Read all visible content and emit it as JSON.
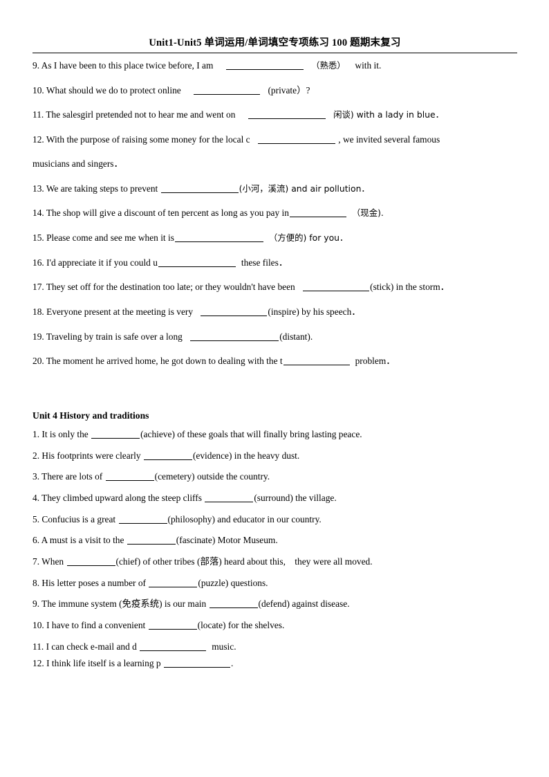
{
  "document": {
    "header_title": "Unit1-Unit5 单词运用/单词填空专项练习 100 题期末复习",
    "section_one": {
      "items": [
        {
          "number": "9.",
          "before": "As I have been to this place twice before, I am",
          "hint": "（熟悉）",
          "after": "with it."
        },
        {
          "number": "10.",
          "before": "What should we do to protect online",
          "hint": "(private）?",
          "after": ""
        },
        {
          "number": "11.",
          "before": "The salesgirl pretended not to hear me and went on",
          "hint": "闲谈) with a lady in blue．",
          "after": ""
        },
        {
          "number": "12.",
          "before": "With the purpose of raising some money for the local c",
          "hint": ", we invited several famous",
          "after": "musicians and singers．"
        },
        {
          "number": "13.",
          "before": "We are taking steps to prevent",
          "hint": "(小河，溪流) and air pollution．",
          "after": ""
        },
        {
          "number": "14.",
          "before": "The shop will give a discount of ten percent as long as you pay in",
          "hint": "（现金).",
          "after": ""
        },
        {
          "number": "15.",
          "before": "Please come and see me when it is",
          "hint": "（方便的) for you．",
          "after": ""
        },
        {
          "number": "16.",
          "before": "I'd appreciate it if you could u",
          "hint": "these files．",
          "after": ""
        },
        {
          "number": "17.",
          "before": "They set off for the destination too late; or they wouldn't have been",
          "hint": "(stick) in the storm．",
          "after": ""
        },
        {
          "number": "18.",
          "before": "Everyone present at the meeting is very",
          "hint": "(inspire) by his speech．",
          "after": ""
        },
        {
          "number": "19.",
          "before": "Traveling by train is safe over a long",
          "hint": "(distant).",
          "after": ""
        },
        {
          "number": "20.",
          "before": "The moment he arrived home, he got down to dealing with the t",
          "hint": "problem．",
          "after": ""
        }
      ]
    },
    "section_two": {
      "title": "Unit 4 History and traditions",
      "items": [
        {
          "number": "1.",
          "before": "It is only the",
          "hint": "(achieve) of these goals that will finally bring lasting peace.",
          "after": ""
        },
        {
          "number": "2.",
          "before": "His footprints were clearly",
          "hint": "(evidence) in the heavy dust.",
          "after": ""
        },
        {
          "number": "3.",
          "before": "There are lots of",
          "hint": "(cemetery) outside the country.",
          "after": ""
        },
        {
          "number": "4.",
          "before": "They climbed upward along the steep cliffs",
          "hint": "(surround) the village.",
          "after": ""
        },
        {
          "number": "5.",
          "before": "Confucius is a great",
          "hint": "(philosophy) and educator in our country.",
          "after": ""
        },
        {
          "number": "6.",
          "before": "A must is a visit to the",
          "hint": "(fascinate) Motor Museum.",
          "after": ""
        },
        {
          "number": "7.",
          "before": "When",
          "hint": "(chief) of other tribes (部落) heard about this,　they were all moved.",
          "after": ""
        },
        {
          "number": "8.",
          "before": "His letter poses a number of",
          "hint": "(puzzle) questions.",
          "after": ""
        },
        {
          "number": "9.",
          "before": "The immune system (免疫系统) is our main",
          "hint": "(defend) against disease.",
          "after": ""
        },
        {
          "number": "10.",
          "before": "I have to find a convenient",
          "hint": "(locate) for the shelves.",
          "after": ""
        },
        {
          "number": "11.",
          "before": "I can check e-mail and d",
          "hint": "music.",
          "after": ""
        },
        {
          "number": "12.",
          "before": "I think life itself is a learning p",
          "hint": ".",
          "after": ""
        }
      ]
    }
  }
}
